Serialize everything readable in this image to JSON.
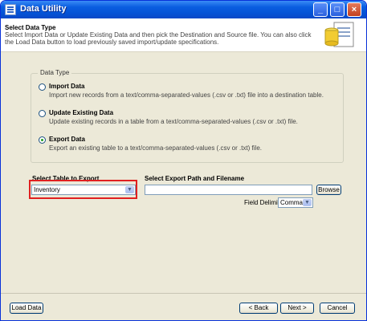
{
  "window": {
    "title": "Data Utility"
  },
  "header": {
    "title": "Select Data Type",
    "description": "Select Import Data or Update Existing Data and then pick the Destination and Source file.  You can also click the Load Data button to load previously saved import/update specifications."
  },
  "data_type": {
    "legend": "Data Type",
    "options": [
      {
        "label": "Import Data",
        "description": "Import new records from a text/comma-separated-values (.csv or .txt) file into a destination table.",
        "selected": false
      },
      {
        "label": "Update Existing Data",
        "description": "Update existing records in a table from a text/comma-separated-values (.csv or .txt) file.",
        "selected": false
      },
      {
        "label": "Export Data",
        "description": "Export an existing table to a text/comma-separated-values (.csv or .txt) file.",
        "selected": true
      }
    ]
  },
  "export": {
    "table_label": "Select Table to Export",
    "table_value": "Inventory",
    "path_label": "Select Export Path and Filename",
    "path_value": "",
    "browse_label": "Browse",
    "delimiter_label": "Field Delimiter",
    "delimiter_value": "Comma"
  },
  "footer": {
    "load_data_label": "Load Data",
    "back_label": "< Back",
    "next_label": "Next >",
    "cancel_label": "Cancel"
  },
  "icons": {
    "app": "data-utility-icon",
    "header": "database-icon",
    "minimize": "minimize-icon",
    "maximize": "maximize-icon",
    "close": "close-icon",
    "dropdown": "chevron-down-icon"
  },
  "colors": {
    "titlebar": "#0a5ee0",
    "highlight": "#e02020",
    "selected_radio": "#21a121"
  }
}
